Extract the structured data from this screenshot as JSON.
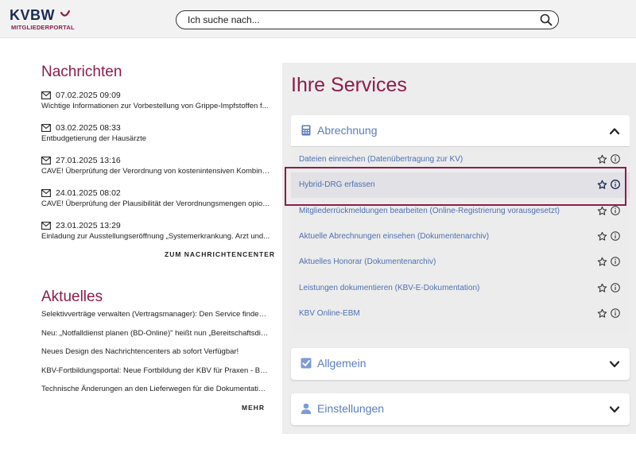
{
  "header": {
    "logo_main": "KVBW",
    "logo_sub": "MITGLIEDERPORTAL",
    "search_placeholder": "Ich suche nach..."
  },
  "news": {
    "title": "Nachrichten",
    "items": [
      {
        "date": "07.02.2025 09:09",
        "text": "Wichtige Informationen zur Vorbestellung von Grippe-Impfstoffen f..."
      },
      {
        "date": "03.02.2025 08:33",
        "text": "Entbudgetierung der Hausärzte"
      },
      {
        "date": "27.01.2025 13:16",
        "text": "CAVE! Überprüfung der Verordnung von kostenintensiven Kombina..."
      },
      {
        "date": "24.01.2025 08:02",
        "text": "CAVE! Überprüfung der Plausibilität der Verordnungsmengen opioi..."
      },
      {
        "date": "23.01.2025 13:29",
        "text": "Einladung zur Ausstellungseröffnung „Systemerkrankung. Arzt und..."
      }
    ],
    "more_link": "ZUM NACHRICHTENCENTER"
  },
  "aktuelles": {
    "title": "Aktuelles",
    "items": [
      "Selektivverträge verwalten (Vertragsmanager): Den Service finden ...",
      "Neu: „Notfalldienst planen (BD-Online)\" heißt nun „Bereitschaftsdie...",
      "Neues Design des Nachrichtencenters ab sofort Verfügbar!",
      "KBV-Fortbildungsportal: Neue Fortbildung der KBV für Praxen - Bar...",
      "Technische Änderungen an den Lieferwegen für die Dokumentatio..."
    ],
    "more_link": "MEHR"
  },
  "services": {
    "title": "Ihre Services",
    "abrechnung": {
      "label": "Abrechnung",
      "items": [
        "Dateien einreichen (Datenübertragung zur KV)",
        "Hybrid-DRG erfassen",
        "Mitgliederrückmeldungen bearbeiten (Online-Registrierung vorausgesetzt)",
        "Aktuelle Abrechnungen einsehen (Dokumentenarchiv)",
        "Aktuelles Honorar (Dokumentenarchiv)",
        "Leistungen dokumentieren (KBV-E-Dokumentation)",
        "KBV Online-EBM"
      ]
    },
    "allgemein": {
      "label": "Allgemein"
    },
    "einstellungen": {
      "label": "Einstellungen"
    }
  },
  "colors": {
    "brand": "#8b1d4a",
    "link": "#4e6fb0",
    "navy": "#1b2a53"
  }
}
